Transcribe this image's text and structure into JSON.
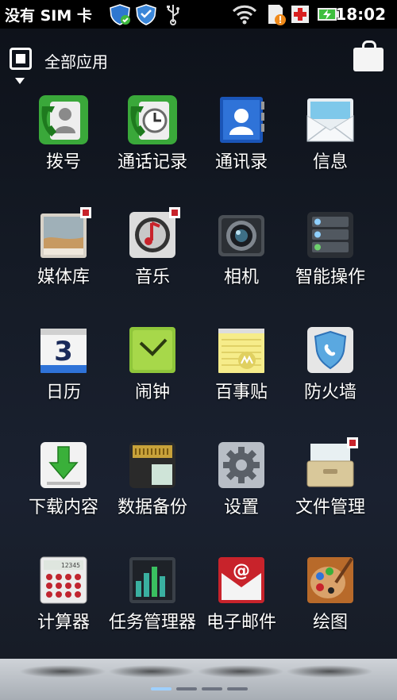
{
  "status_bar": {
    "carrier": "没有 SIM 卡",
    "time": "18:02",
    "icons": [
      "shield-check-icon",
      "shield-icon",
      "usb-icon",
      "wifi-icon",
      "sd-card-warning-icon",
      "red-cross-icon",
      "battery-charging-icon"
    ]
  },
  "header": {
    "title": "全部应用",
    "icons": [
      "all-apps-icon",
      "dropdown-caret-icon",
      "market-bag-icon"
    ]
  },
  "apps": [
    {
      "label": "拨号",
      "icon": "phone-dialer-icon"
    },
    {
      "label": "通话记录",
      "icon": "call-log-icon"
    },
    {
      "label": "通讯录",
      "icon": "contacts-icon"
    },
    {
      "label": "信息",
      "icon": "messages-icon"
    },
    {
      "label": "媒体库",
      "icon": "gallery-icon"
    },
    {
      "label": "音乐",
      "icon": "music-icon"
    },
    {
      "label": "相机",
      "icon": "camera-icon"
    },
    {
      "label": "智能操作",
      "icon": "smart-actions-icon"
    },
    {
      "label": "日历",
      "icon": "calendar-icon",
      "day": "3"
    },
    {
      "label": "闹钟",
      "icon": "alarm-clock-icon"
    },
    {
      "label": "百事贴",
      "icon": "notes-icon"
    },
    {
      "label": "防火墙",
      "icon": "firewall-icon"
    },
    {
      "label": "下载内容",
      "icon": "downloads-icon"
    },
    {
      "label": "数据备份",
      "icon": "backup-icon"
    },
    {
      "label": "设置",
      "icon": "settings-gear-icon"
    },
    {
      "label": "文件管理",
      "icon": "file-manager-icon"
    },
    {
      "label": "计算器",
      "icon": "calculator-icon",
      "display": "12345"
    },
    {
      "label": "任务管理器",
      "icon": "task-manager-icon"
    },
    {
      "label": "电子邮件",
      "icon": "email-icon"
    },
    {
      "label": "绘图",
      "icon": "paint-palette-icon"
    }
  ],
  "page_indicator": {
    "pages": 4,
    "current": 1
  },
  "colors": {
    "accent": "#9fd0ff",
    "badge": "#c8232b"
  }
}
